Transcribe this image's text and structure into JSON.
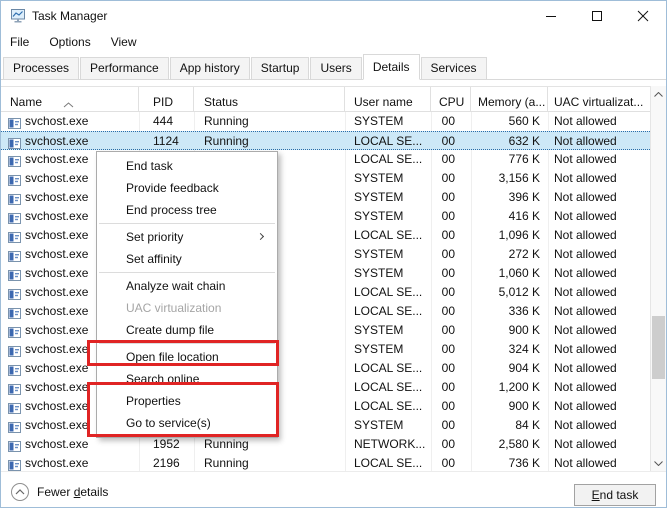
{
  "window": {
    "title": "Task Manager"
  },
  "menu_bar": {
    "items": [
      "File",
      "Options",
      "View"
    ]
  },
  "tab_bar": {
    "tabs": [
      {
        "label": "Processes",
        "selected": false
      },
      {
        "label": "Performance",
        "selected": false
      },
      {
        "label": "App history",
        "selected": false
      },
      {
        "label": "Startup",
        "selected": false
      },
      {
        "label": "Users",
        "selected": false
      },
      {
        "label": "Details",
        "selected": true
      },
      {
        "label": "Services",
        "selected": false
      }
    ]
  },
  "table": {
    "columns": [
      {
        "label": "Name",
        "sort": "ascending"
      },
      {
        "label": "PID"
      },
      {
        "label": "Status"
      },
      {
        "label": "User name"
      },
      {
        "label": "CPU"
      },
      {
        "label": "Memory (a..."
      },
      {
        "label": "UAC virtualizat..."
      }
    ],
    "rows": [
      {
        "name": "svchost.exe",
        "pid": "444",
        "status": "Running",
        "user": "SYSTEM",
        "cpu": "00",
        "mem": "560 K",
        "uac": "Not allowed",
        "selected": false
      },
      {
        "name": "svchost.exe",
        "pid": "1124",
        "status": "Running",
        "user": "LOCAL SE...",
        "cpu": "00",
        "mem": "632 K",
        "uac": "Not allowed",
        "selected": true
      },
      {
        "name": "svchost.exe",
        "pid": "",
        "status": "",
        "user": "LOCAL SE...",
        "cpu": "00",
        "mem": "776 K",
        "uac": "Not allowed",
        "selected": false
      },
      {
        "name": "svchost.exe",
        "pid": "",
        "status": "",
        "user": "SYSTEM",
        "cpu": "00",
        "mem": "3,156 K",
        "uac": "Not allowed",
        "selected": false
      },
      {
        "name": "svchost.exe",
        "pid": "",
        "status": "",
        "user": "SYSTEM",
        "cpu": "00",
        "mem": "396 K",
        "uac": "Not allowed",
        "selected": false
      },
      {
        "name": "svchost.exe",
        "pid": "",
        "status": "",
        "user": "SYSTEM",
        "cpu": "00",
        "mem": "416 K",
        "uac": "Not allowed",
        "selected": false
      },
      {
        "name": "svchost.exe",
        "pid": "",
        "status": "",
        "user": "LOCAL SE...",
        "cpu": "00",
        "mem": "1,096 K",
        "uac": "Not allowed",
        "selected": false
      },
      {
        "name": "svchost.exe",
        "pid": "",
        "status": "",
        "user": "SYSTEM",
        "cpu": "00",
        "mem": "272 K",
        "uac": "Not allowed",
        "selected": false
      },
      {
        "name": "svchost.exe",
        "pid": "",
        "status": "",
        "user": "SYSTEM",
        "cpu": "00",
        "mem": "1,060 K",
        "uac": "Not allowed",
        "selected": false
      },
      {
        "name": "svchost.exe",
        "pid": "",
        "status": "",
        "user": "LOCAL SE...",
        "cpu": "00",
        "mem": "5,012 K",
        "uac": "Not allowed",
        "selected": false
      },
      {
        "name": "svchost.exe",
        "pid": "",
        "status": "",
        "user": "LOCAL SE...",
        "cpu": "00",
        "mem": "336 K",
        "uac": "Not allowed",
        "selected": false
      },
      {
        "name": "svchost.exe",
        "pid": "",
        "status": "",
        "user": "SYSTEM",
        "cpu": "00",
        "mem": "900 K",
        "uac": "Not allowed",
        "selected": false
      },
      {
        "name": "svchost.exe",
        "pid": "",
        "status": "",
        "user": "SYSTEM",
        "cpu": "00",
        "mem": "324 K",
        "uac": "Not allowed",
        "selected": false
      },
      {
        "name": "svchost.exe",
        "pid": "",
        "status": "",
        "user": "LOCAL SE...",
        "cpu": "00",
        "mem": "904 K",
        "uac": "Not allowed",
        "selected": false
      },
      {
        "name": "svchost.exe",
        "pid": "",
        "status": "",
        "user": "LOCAL SE...",
        "cpu": "00",
        "mem": "1,200 K",
        "uac": "Not allowed",
        "selected": false
      },
      {
        "name": "svchost.exe",
        "pid": "",
        "status": "",
        "user": "LOCAL SE...",
        "cpu": "00",
        "mem": "900 K",
        "uac": "Not allowed",
        "selected": false
      },
      {
        "name": "svchost.exe",
        "pid": "",
        "status": "",
        "user": "SYSTEM",
        "cpu": "00",
        "mem": "84 K",
        "uac": "Not allowed",
        "selected": false
      },
      {
        "name": "svchost.exe",
        "pid": "1952",
        "status": "Running",
        "user": "NETWORK...",
        "cpu": "00",
        "mem": "2,580 K",
        "uac": "Not allowed",
        "selected": false
      },
      {
        "name": "svchost.exe",
        "pid": "2196",
        "status": "Running",
        "user": "LOCAL SE...",
        "cpu": "00",
        "mem": "736 K",
        "uac": "Not allowed",
        "selected": false
      }
    ]
  },
  "context_menu": {
    "items": [
      {
        "label": "End task",
        "type": "item"
      },
      {
        "label": "Provide feedback",
        "type": "item"
      },
      {
        "label": "End process tree",
        "type": "item"
      },
      {
        "type": "separator"
      },
      {
        "label": "Set priority",
        "type": "submenu"
      },
      {
        "label": "Set affinity",
        "type": "item"
      },
      {
        "type": "separator"
      },
      {
        "label": "Analyze wait chain",
        "type": "item"
      },
      {
        "label": "UAC virtualization",
        "type": "item",
        "disabled": true
      },
      {
        "label": "Create dump file",
        "type": "item"
      },
      {
        "type": "separator"
      },
      {
        "label": "Open file location",
        "type": "item",
        "highlighted": true
      },
      {
        "label": "Search online",
        "type": "item"
      },
      {
        "label": "Properties",
        "type": "item",
        "highlighted": true
      },
      {
        "label": "Go to service(s)",
        "type": "item",
        "highlighted": true
      }
    ]
  },
  "footer": {
    "fewer_details_label": "Fewer details",
    "end_task_label": "End task"
  },
  "colors": {
    "selection_bg": "#cde8f7",
    "selection_border": "#2b6da8",
    "highlight_red": "#e02424",
    "icon_blue": "#3c68b0",
    "scroll_thumb": "#cdcdcd"
  }
}
